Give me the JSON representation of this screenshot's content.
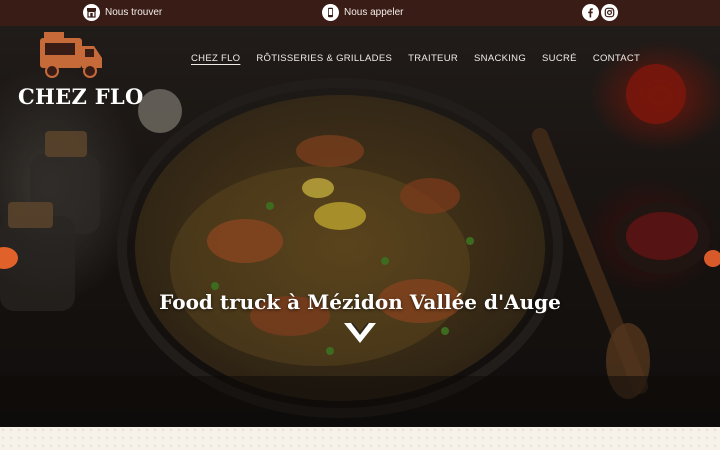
{
  "topbar": {
    "find_label": "Nous trouver",
    "call_label": "Nous appeler"
  },
  "brand": {
    "name": "CHEZ FLO",
    "accent": "#e0612a",
    "topbar_color": "#3a1c16"
  },
  "nav": {
    "items": [
      {
        "label": "CHEZ FLO",
        "active": true
      },
      {
        "label": "RÔTISSERIES & GRILLADES"
      },
      {
        "label": "TRAITEUR"
      },
      {
        "label": "SNACKING"
      },
      {
        "label": "SUCRÉ"
      },
      {
        "label": "CONTACT"
      }
    ]
  },
  "hero": {
    "headline": "Food truck à Mézidon Vallée d'Auge"
  },
  "icons": {
    "find": "store-icon",
    "call": "phone-icon",
    "facebook": "facebook-icon",
    "instagram": "instagram-icon",
    "scroll": "chevron-down-icon"
  }
}
